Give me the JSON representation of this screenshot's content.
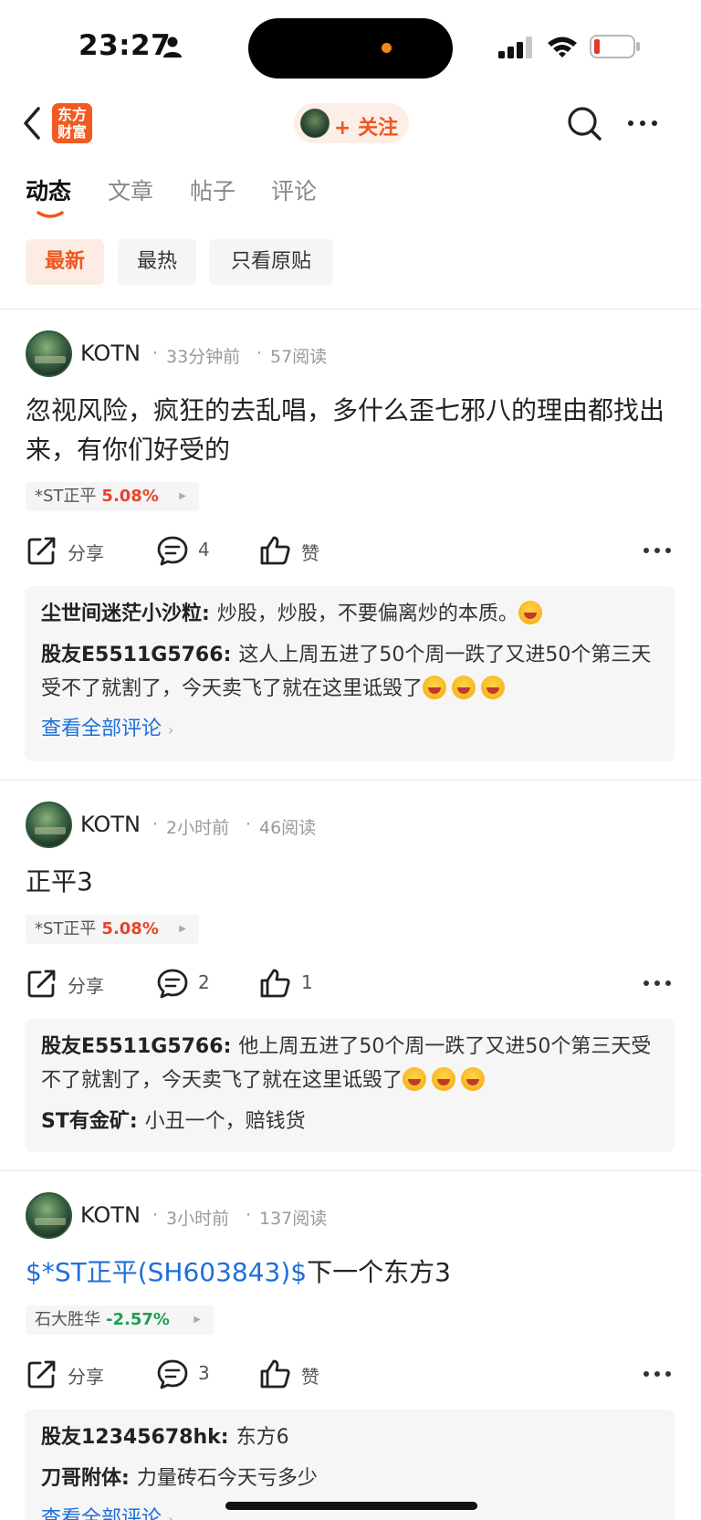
{
  "status_bar": {
    "time": "23:27"
  },
  "header": {
    "logo_text_line1": "东方",
    "logo_text_line2": "财富",
    "follow_label": "+ 关注"
  },
  "tabs": [
    {
      "label": "动态",
      "active": true
    },
    {
      "label": "文章",
      "active": false
    },
    {
      "label": "帖子",
      "active": false
    },
    {
      "label": "评论",
      "active": false
    }
  ],
  "filters": [
    {
      "label": "最新",
      "active": true
    },
    {
      "label": "最热",
      "active": false
    },
    {
      "label": "只看原贴",
      "active": false
    }
  ],
  "posts": [
    {
      "author": "KOTN",
      "time": "33分钟前",
      "reads": "57阅读",
      "text": "忽视风险，疯狂的去乱唱，多什么歪七邪八的理由都找出来，有你们好受的",
      "stock_name": "*ST正平",
      "stock_change": "5.08%",
      "share_label": "分享",
      "comment_count": "4",
      "like_label": "赞",
      "comments": [
        {
          "name": "尘世间迷茫小沙粒",
          "text": "炒股，炒股，不要偏离炒的本质。"
        },
        {
          "name": "股友E5511G5766",
          "text": "这人上周五进了50个周一跌了又进50个第三天受不了就割了，今天卖飞了就在这里诋毁了"
        }
      ],
      "view_all": "查看全部评论"
    },
    {
      "author": "KOTN",
      "time": "2小时前",
      "reads": "46阅读",
      "text": "正平3",
      "stock_name": "*ST正平",
      "stock_change": "5.08%",
      "share_label": "分享",
      "comment_count": "2",
      "like_label": "1",
      "comments": [
        {
          "name": "股友E5511G5766",
          "text": "他上周五进了50个周一跌了又进50个第三天受不了就割了，今天卖飞了就在这里诋毁了"
        },
        {
          "name": "ST有金矿",
          "text": "小丑一个，赔钱货"
        }
      ]
    },
    {
      "author": "KOTN",
      "time": "3小时前",
      "reads": "137阅读",
      "text_link": "$*ST正平(SH603843)$",
      "text": "下一个东方3",
      "stock_name": "石大胜华",
      "stock_change": "-2.57%",
      "share_label": "分享",
      "comment_count": "3",
      "like_label": "赞",
      "comments": [
        {
          "name": "股友12345678hk",
          "text": "东方6"
        },
        {
          "name": "刀哥附体",
          "text": "力量砖石今天亏多少"
        }
      ],
      "view_all": "查看全部评论"
    }
  ],
  "meta_separator": "·",
  "colors": {
    "accent": "#f0561e",
    "link": "#1e6fd9",
    "up": "#e5452c",
    "down": "#1f9e53"
  }
}
